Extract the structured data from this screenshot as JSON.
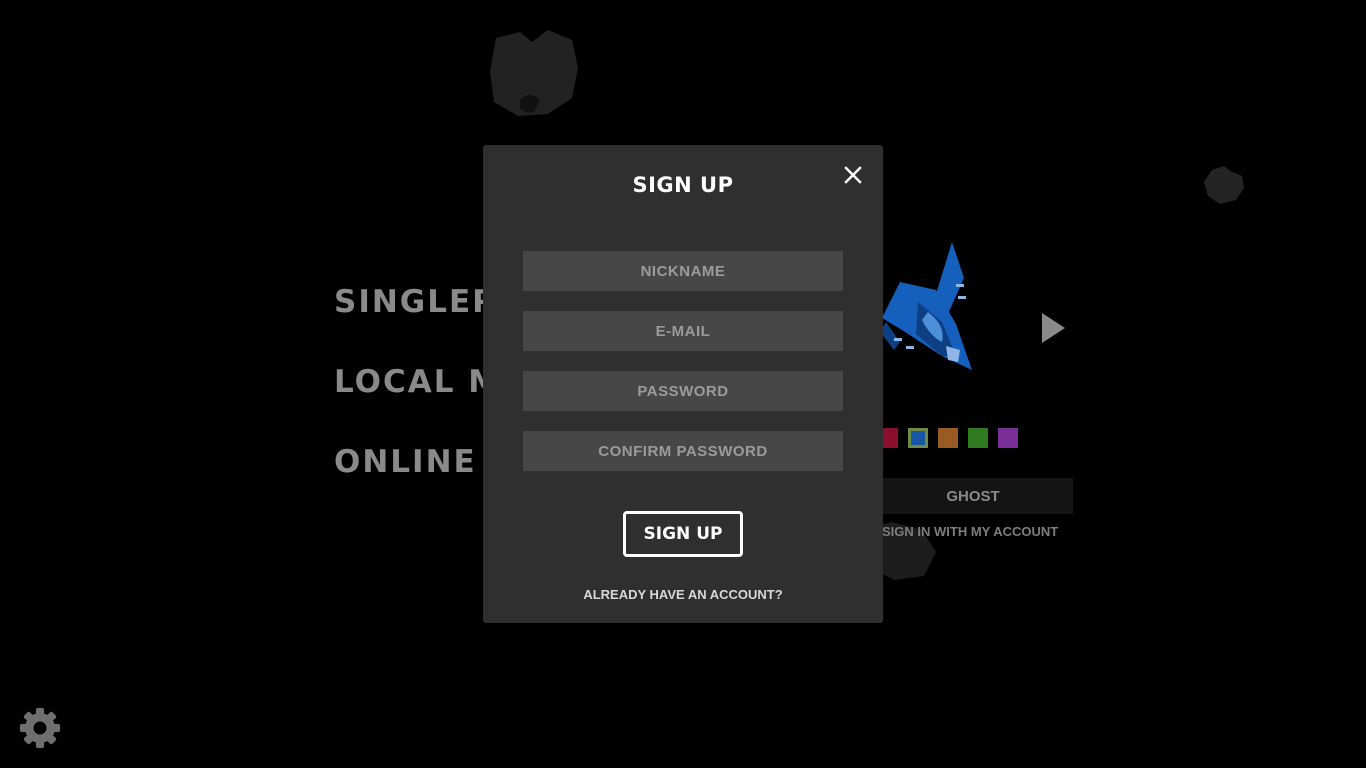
{
  "menu": {
    "items": [
      {
        "label": "SINGLEPLAYER"
      },
      {
        "label": "LOCAL MULTIPLAYER"
      },
      {
        "label": "ONLINE MULTIPLAYER"
      }
    ]
  },
  "ship_panel": {
    "colors": [
      "#8a0f2e",
      "#1a56a6",
      "#9a5a23",
      "#2f7a1f",
      "#7a2e95"
    ],
    "selected_color": "#1a56a6",
    "nickname": "GHOST",
    "signin_link": "SIGN IN WITH MY ACCOUNT"
  },
  "modal": {
    "title": "SIGN UP",
    "fields": {
      "nickname_placeholder": "NICKNAME",
      "email_placeholder": "E-MAIL",
      "password_placeholder": "PASSWORD",
      "confirm_placeholder": "CONFIRM PASSWORD"
    },
    "submit_label": "SIGN UP",
    "login_link": "ALREADY HAVE AN ACCOUNT?"
  },
  "icons": {
    "close": "close-icon",
    "settings": "gear-icon",
    "next": "play-arrow-icon"
  }
}
